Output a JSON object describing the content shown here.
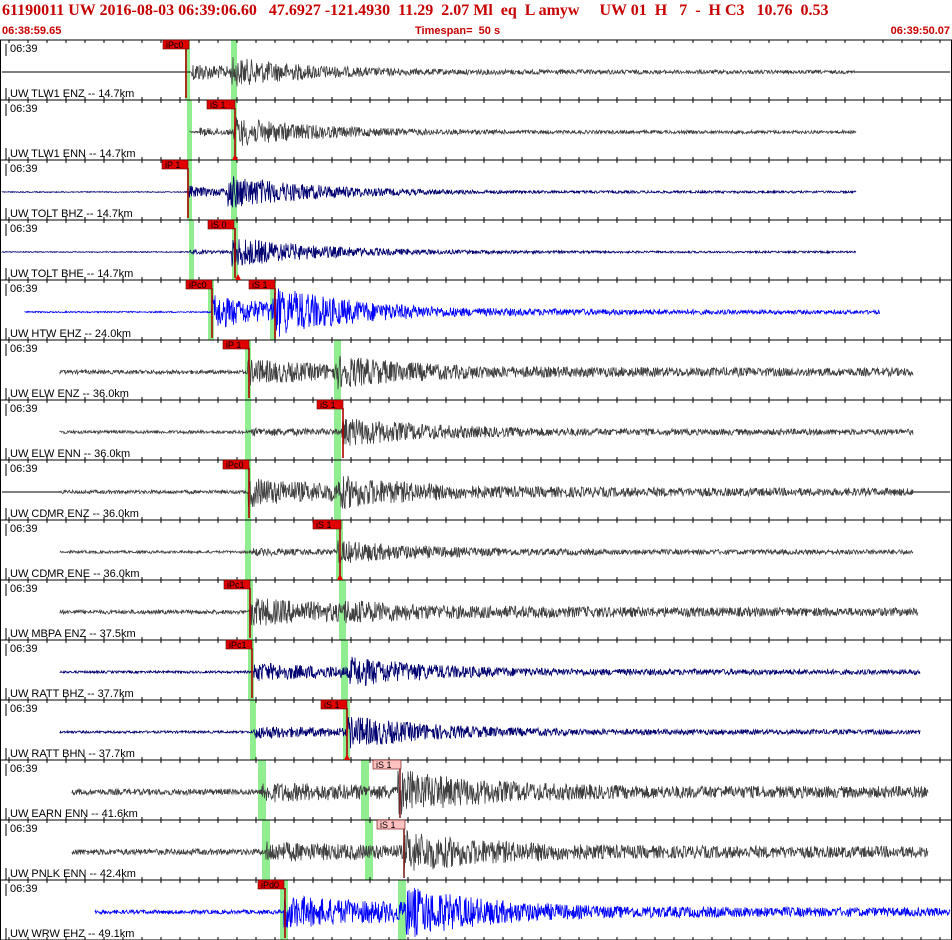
{
  "header": {
    "title": "61190011 UW 2016-08-03 06:39:06.60   47.6927 -121.4930  11.29  2.07 Ml  eq  L amyw     UW 01  H   7  -  H C3   10.76  0.53",
    "start_time": "06:38:59.65",
    "timespan": "Timespan=  50 s",
    "end_time": "06:39:50.07"
  },
  "colors": {
    "header_text": "#c80000",
    "pick_red": "#e00000",
    "pick_pink": "#ffc0c0",
    "pick_band": "#90ee90",
    "trace_gray": "#404040",
    "trace_navy": "#000070",
    "trace_blue": "#0000ff"
  },
  "panels": [
    {
      "time_label": "06:39",
      "station_label": "UW TLW1 ENZ -- 14.7km",
      "color": "gray",
      "picks": [
        {
          "label": "iPc0",
          "style": "red"
        }
      ]
    },
    {
      "time_label": "06:39",
      "station_label": "UW TLW1 ENN -- 14.7km",
      "color": "gray",
      "picks": [
        {
          "label": "iS 1",
          "style": "red"
        }
      ]
    },
    {
      "time_label": "06:39",
      "station_label": "UW TOLT BHZ -- 14.7km",
      "color": "navy",
      "picks": [
        {
          "label": "iP 1",
          "style": "red"
        }
      ]
    },
    {
      "time_label": "06:39",
      "station_label": "UW TOLT BHE -- 14.7km",
      "color": "navy",
      "picks": [
        {
          "label": "iS 0",
          "style": "red"
        }
      ]
    },
    {
      "time_label": "06:39",
      "station_label": "UW HTW EHZ -- 24.0km",
      "color": "blue",
      "picks": [
        {
          "label": "iPc0",
          "style": "red"
        },
        {
          "label": "iS 1",
          "style": "red"
        }
      ]
    },
    {
      "time_label": "06:39",
      "station_label": "UW ELW ENZ -- 36.0km",
      "color": "gray",
      "picks": [
        {
          "label": "iP 1",
          "style": "red"
        }
      ]
    },
    {
      "time_label": "06:39",
      "station_label": "UW ELW ENN -- 36.0km",
      "color": "gray",
      "picks": [
        {
          "label": "iS 1",
          "style": "red"
        }
      ]
    },
    {
      "time_label": "06:39",
      "station_label": "UW CDMR ENZ -- 36.0km",
      "color": "gray",
      "picks": [
        {
          "label": "iPc0",
          "style": "red"
        }
      ]
    },
    {
      "time_label": "06:39",
      "station_label": "UW CDMR ENE -- 36.0km",
      "color": "gray",
      "picks": [
        {
          "label": "iS 1",
          "style": "red"
        }
      ]
    },
    {
      "time_label": "06:39",
      "station_label": "UW MBPA ENZ -- 37.5km",
      "color": "gray",
      "picks": [
        {
          "label": "iPc1",
          "style": "red"
        }
      ]
    },
    {
      "time_label": "06:39",
      "station_label": "UW RATT BHZ -- 37.7km",
      "color": "navy",
      "picks": [
        {
          "label": "iPc1",
          "style": "red"
        }
      ]
    },
    {
      "time_label": "06:39",
      "station_label": "UW RATT BHN -- 37.7km",
      "color": "navy",
      "picks": [
        {
          "label": "iS 1",
          "style": "red"
        }
      ]
    },
    {
      "time_label": "06:39",
      "station_label": "UW EARN ENN -- 41.6km",
      "color": "gray",
      "picks": [
        {
          "label": "iS 1",
          "style": "pink"
        }
      ]
    },
    {
      "time_label": "06:39",
      "station_label": "UW PNLK ENN -- 42.4km",
      "color": "gray",
      "picks": [
        {
          "label": "iS 1",
          "style": "pink"
        }
      ]
    },
    {
      "time_label": "06:39",
      "station_label": "UW WRW EHZ -- 49.1km",
      "color": "blue",
      "picks": [
        {
          "label": "iPd0",
          "style": "red"
        }
      ]
    }
  ]
}
